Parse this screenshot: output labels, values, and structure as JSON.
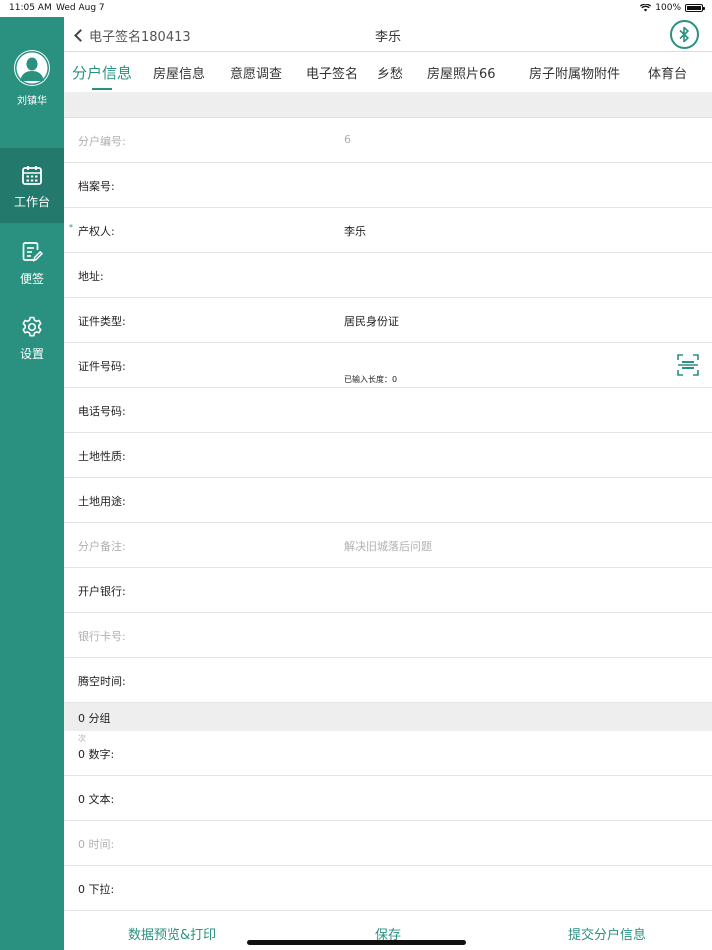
{
  "status_bar": {
    "time": "11:05 AM",
    "date": "Wed Aug 7",
    "battery": "100%"
  },
  "sidebar": {
    "user_name": "刘镇华",
    "items": [
      {
        "label": "工作台",
        "icon": "calendar-icon",
        "active": true
      },
      {
        "label": "便签",
        "icon": "note-edit-icon",
        "active": false
      },
      {
        "label": "设置",
        "icon": "gear-icon",
        "active": false
      }
    ]
  },
  "navbar": {
    "back_label": "电子签名180413",
    "title": "李乐",
    "bluetooth_icon": "bluetooth-icon"
  },
  "tabs": [
    {
      "label": "分户信息",
      "active": true
    },
    {
      "label": "房屋信息"
    },
    {
      "label": "意愿调查"
    },
    {
      "label": "电子签名"
    },
    {
      "label": "乡愁"
    },
    {
      "label": "房屋照片66"
    },
    {
      "label": "房子附属物附件"
    },
    {
      "label": "体育台"
    }
  ],
  "form": {
    "household_no": {
      "label": "分户编号:",
      "value": "6"
    },
    "archive_no": {
      "label": "档案号:",
      "value": ""
    },
    "owner": {
      "label": "产权人:",
      "value": "李乐",
      "required_mark": "*"
    },
    "address": {
      "label": "地址:",
      "value": ""
    },
    "id_type": {
      "label": "证件类型:",
      "value": "居民身份证"
    },
    "id_number": {
      "label": "证件号码:",
      "value": "",
      "hint": "已输入长度：0"
    },
    "phone": {
      "label": "电话号码:",
      "value": ""
    },
    "land_nature": {
      "label": "土地性质:",
      "value": ""
    },
    "land_use": {
      "label": "土地用途:",
      "value": ""
    },
    "remark": {
      "label": "分户备注:",
      "placeholder": "解决旧城落后问题"
    },
    "bank": {
      "label": "开户银行:",
      "value": ""
    },
    "bank_card": {
      "label": "银行卡号:",
      "value": ""
    },
    "vacate_time": {
      "label": "腾空时间:",
      "value": ""
    }
  },
  "group": {
    "header": "0  分组",
    "tiny_label": "次",
    "rows": [
      {
        "label": "0  数字:"
      },
      {
        "label": "0  文本:"
      },
      {
        "label": "0    时间:"
      },
      {
        "label": "0  下拉:"
      }
    ]
  },
  "bottom_bar": {
    "preview_print": "数据预览&打印",
    "save": "保存",
    "submit": "提交分户信息"
  },
  "colors": {
    "accent": "#2a9180",
    "sidebar_active": "#23796b"
  }
}
